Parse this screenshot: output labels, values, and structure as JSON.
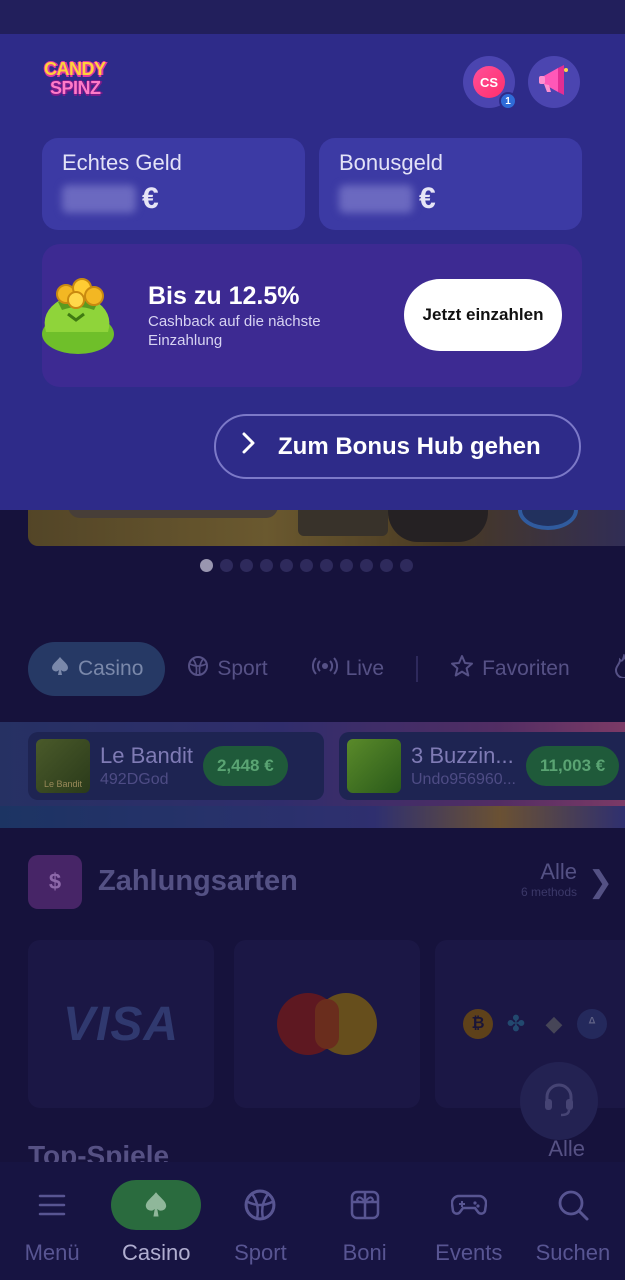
{
  "header": {
    "logo_line1": "CANDY",
    "logo_line2": "SPINZ",
    "cs_label": "CS",
    "cs_badge": "1"
  },
  "balances": {
    "real_label": "Echtes Geld",
    "real_currency": "€",
    "bonus_label": "Bonusgeld",
    "bonus_currency": "€"
  },
  "cashback": {
    "title": "Bis zu 12.5%",
    "subtitle": "Cashback auf die nächste Einzahlung",
    "button": "Jetzt einzahlen"
  },
  "bonus_hub": {
    "label": "Zum Bonus Hub gehen"
  },
  "carousel": {
    "dot_count": 11,
    "active_index": 0
  },
  "tabs": [
    {
      "label": "Casino",
      "icon": "spade-icon"
    },
    {
      "label": "Sport",
      "icon": "ball-icon"
    },
    {
      "label": "Live",
      "icon": "broadcast-icon"
    },
    {
      "label": "Favoriten",
      "icon": "star-icon"
    }
  ],
  "winners": [
    {
      "game": "Le Bandit",
      "user": "492DGod",
      "amount": "2,448 €",
      "thumb": "Le Bandit"
    },
    {
      "game": "3 Buzzin...",
      "user": "Undo956960...",
      "amount": "11,003 €",
      "thumb": ""
    }
  ],
  "payments": {
    "title": "Zahlungsarten",
    "all_label": "Alle",
    "count_label": "6 methods",
    "visa": "VISA"
  },
  "top_games": {
    "title": "Top-Spiele",
    "all_label": "Alle"
  },
  "bottom_nav": [
    {
      "label": "Menü",
      "icon": "menu-icon"
    },
    {
      "label": "Casino",
      "icon": "spade-icon"
    },
    {
      "label": "Sport",
      "icon": "ball-icon"
    },
    {
      "label": "Boni",
      "icon": "gift-icon"
    },
    {
      "label": "Events",
      "icon": "gamepad-icon"
    },
    {
      "label": "Suchen",
      "icon": "search-icon"
    }
  ],
  "colors": {
    "panel_bg": "#2e2b89",
    "page_bg": "#1a1646",
    "active_nav": "#2a6b3e",
    "win_amount": "#1f5a3a"
  }
}
